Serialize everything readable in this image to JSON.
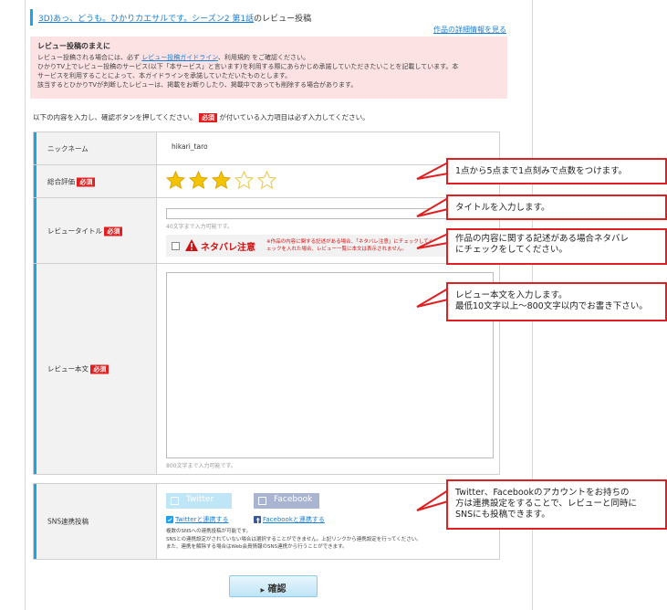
{
  "header": {
    "title_link": "3D)あっ、どうも。ひかりカエサルです。シーズン2 第1話",
    "title_suffix": "のレビュー投稿",
    "detail_link": "作品の詳細情報を見る"
  },
  "notice": {
    "title": "レビュー投稿のまえに",
    "line1_a": "レビュー投稿される場合には、必ず",
    "line1_link": "レビュー投稿ガイドライン",
    "line1_b": "、利用規約 をご確認ください。",
    "line2": "ひかりTV上でレビュー投稿のサービス(以下「本サービス」と言います)を利用する際にあらかじめ承諾していただきたいことを記載しています。本",
    "line3": "サービスを利用することによって、本ガイドラインを承諾していただいたものとします。",
    "line4": "該当するとひかりTVが判断したレビューは、掲載をお断りしたり、掲載中であっても削除する場合があります。"
  },
  "instruction": {
    "before": "以下の内容を入力し、確認ボタンを押してください。",
    "after": "が付いている入力項目は必ず入力してください。"
  },
  "required_badge": "必須",
  "form": {
    "nickname_label": "ニックネーム",
    "nickname_value": "hikari_taro",
    "rating_label": "総合評価",
    "rating_value": 3,
    "rating_max": 5,
    "title_label": "レビュータイトル",
    "title_hint": "40文字まで入力可能です。",
    "spoiler_label": "ネタバレ注意",
    "spoiler_note": "※作品の内容に関する記述がある場合、「ネタバレ注意」にチェックしてください。チェックを入れた場合、レビュー一覧に本文は表示されません。",
    "body_label": "レビュー本文",
    "body_hint": "800文字まで入力可能です。",
    "sns_label": "SNS連携投稿"
  },
  "sns": {
    "twitter_button": "Twitter",
    "facebook_button": "Facebook",
    "twitter_link": "Twitterと連携する",
    "facebook_link": "Facebookと連携する",
    "note1": "複数のSNSへの連携投稿が可能です。",
    "note2": "SNSとの連携設定がされていない場合は選択することができません。上記リンクから連携設定を行ってください。",
    "note3": "また、連携を解除する場合はWeb会員情報のSNS連携から行うことができます。",
    "twitter_color": "#bfe6f7",
    "facebook_color": "#a9b4d0"
  },
  "confirm_button": "確認",
  "callouts": {
    "rating": "1点から5点まで1点刻みで点数をつけます。",
    "title": "タイトルを入力します。",
    "spoiler_1": "作品の内容に関する記述がある場合ネタバレ",
    "spoiler_2": "にチェックをしてください。",
    "body_1": "レビュー本文を入力します。",
    "body_2": "最低10文字以上〜800文字以内でお書き下さい。",
    "sns_1": "Twitter、Facebookのアカウントをお持ちの",
    "sns_2": "方は連携設定をすることで、レビューと同時に",
    "sns_3": "SNSにも投稿できます。"
  },
  "colors": {
    "accent": "#1aa5e6",
    "required": "#e02020",
    "notice_bg": "#fde2e4",
    "star": "#f5c400"
  }
}
